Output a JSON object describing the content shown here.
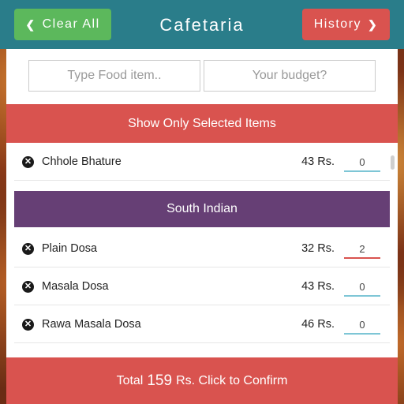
{
  "header": {
    "title": "Cafetaria",
    "clear_label": "Clear All",
    "history_label": "History",
    "clear_icon": "chevron-left-icon",
    "history_icon": "chevron-right-icon",
    "color": "#2a7d8a"
  },
  "search": {
    "food_placeholder": "Type Food item..",
    "budget_placeholder": "Your budget?"
  },
  "filter": {
    "label": "Show Only Selected Items"
  },
  "items_top": [
    {
      "name": "Chhole Bhature",
      "price": "43 Rs.",
      "qty": "0"
    }
  ],
  "category": {
    "label": "South Indian",
    "color": "#663f75"
  },
  "items": [
    {
      "name": "Plain Dosa",
      "price": "32 Rs.",
      "qty": "2"
    },
    {
      "name": "Masala Dosa",
      "price": "43 Rs.",
      "qty": "0"
    },
    {
      "name": "Rawa Masala Dosa",
      "price": "46 Rs.",
      "qty": "0"
    }
  ],
  "footer": {
    "prefix": "Total",
    "amount": "159",
    "suffix": "Rs. Click to Confirm",
    "color": "#d9534f"
  }
}
